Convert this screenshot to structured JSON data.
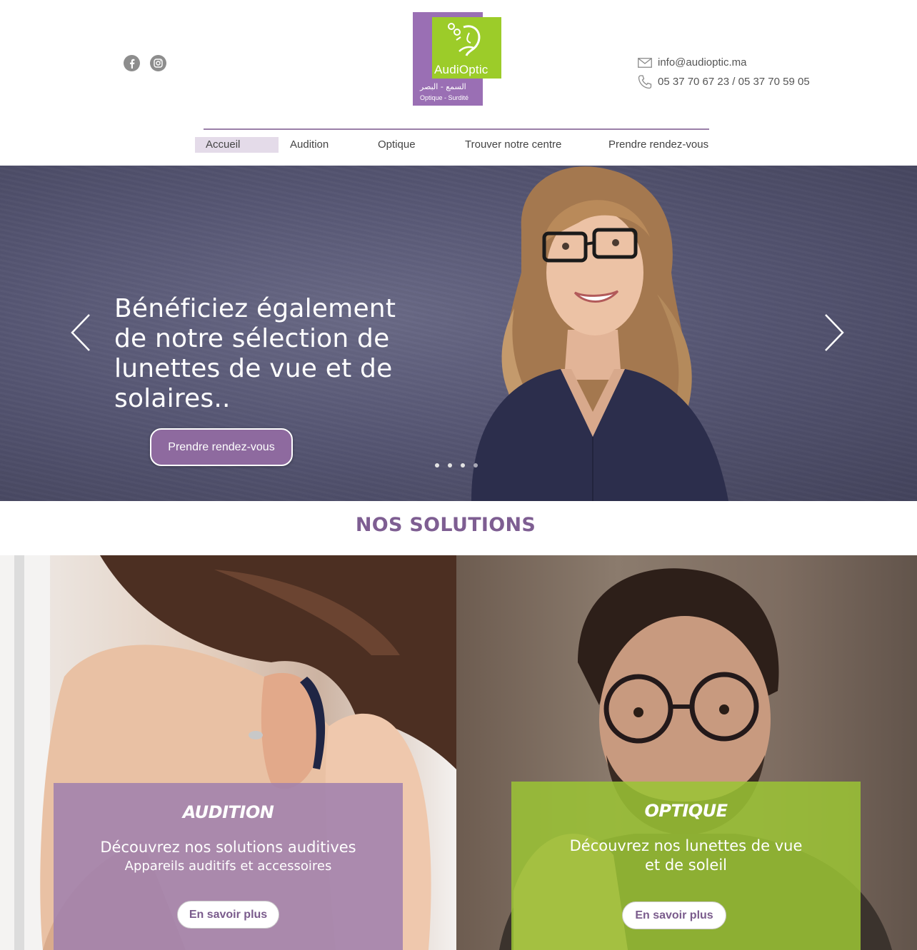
{
  "header": {
    "social": [
      {
        "name": "facebook-icon"
      },
      {
        "name": "instagram-icon"
      }
    ],
    "logo": {
      "brand": "AudiOptic",
      "arabic": "السمع - البصر",
      "subtitle": "Optique - Surdité"
    },
    "contact": {
      "email": "info@audioptic.ma",
      "phone": "05 37 70 67 23 / 05 37 70 59 05"
    },
    "nav": [
      {
        "label": "Accueil",
        "active": true
      },
      {
        "label": "Audition"
      },
      {
        "label": "Optique"
      },
      {
        "label": "Trouver notre centre"
      },
      {
        "label": "Prendre rendez-vous"
      }
    ]
  },
  "hero": {
    "title": "Bénéficiez également de notre sélection de lunettes de vue et de solaires..",
    "button": "Prendre rendez-vous",
    "slides_count": 4,
    "active_slide": 1
  },
  "solutions": {
    "title": "NOS SOLUTIONS",
    "audition": {
      "title": "AUDITION",
      "line1": "Découvrez nos solutions auditives",
      "line2": "Appareils auditifs et accessoires",
      "button": "En savoir plus"
    },
    "optique": {
      "title": "OPTIQUE",
      "line1": "Découvrez nos lunettes de vue",
      "line2": "et de soleil",
      "button": "En savoir plus"
    }
  },
  "colors": {
    "purple": "#9a6fb4",
    "green": "#9ccc29",
    "heading": "#7e5e92"
  }
}
